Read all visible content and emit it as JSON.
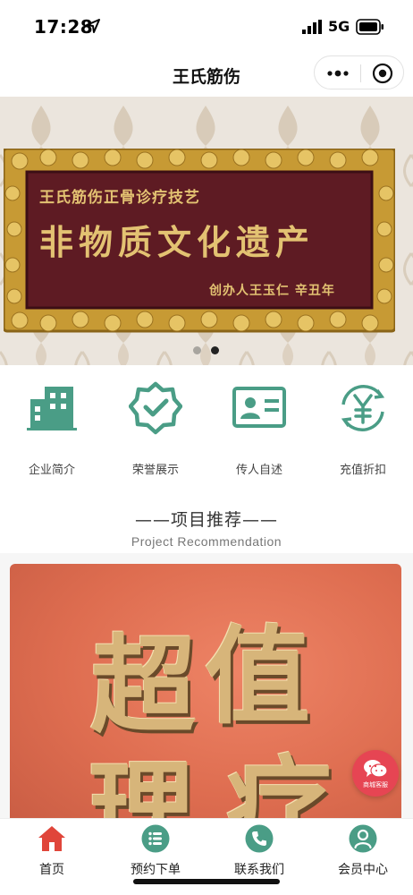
{
  "status_bar": {
    "time": "17:28",
    "network": "5G"
  },
  "nav": {
    "title": "王氏筋伤"
  },
  "banner": {
    "plaque_line1": "王氏筋伤正骨诊疗技艺",
    "plaque_line2": "非物质文化遗产",
    "plaque_line3": "创办人王玉仁 辛丑年",
    "active_slide": 2,
    "slide_count": 2
  },
  "quick_menu": {
    "items": [
      {
        "label": "企业简介",
        "icon": "building-icon"
      },
      {
        "label": "荣誉展示",
        "icon": "badge-check-icon"
      },
      {
        "label": "传人自述",
        "icon": "id-card-icon"
      },
      {
        "label": "充值折扣",
        "icon": "yen-cycle-icon"
      }
    ]
  },
  "section": {
    "title": "——项目推荐——",
    "subtitle": "Project Recommendation"
  },
  "recommend": {
    "chars": [
      "超",
      "值",
      "理",
      "疗"
    ]
  },
  "customer_service": {
    "label": "商城客服",
    "icon": "wechat-icon"
  },
  "tab_bar": {
    "items": [
      {
        "label": "首页",
        "icon": "home-icon",
        "active": true
      },
      {
        "label": "预约下单",
        "icon": "list-icon",
        "active": false
      },
      {
        "label": "联系我们",
        "icon": "phone-icon",
        "active": false
      },
      {
        "label": "会员中心",
        "icon": "user-icon",
        "active": false
      }
    ]
  },
  "colors": {
    "accent_green": "#4a9d86",
    "tab_active_red": "#e0453a",
    "cs_red": "#e64553",
    "plaque_gold": "#e3c272"
  }
}
